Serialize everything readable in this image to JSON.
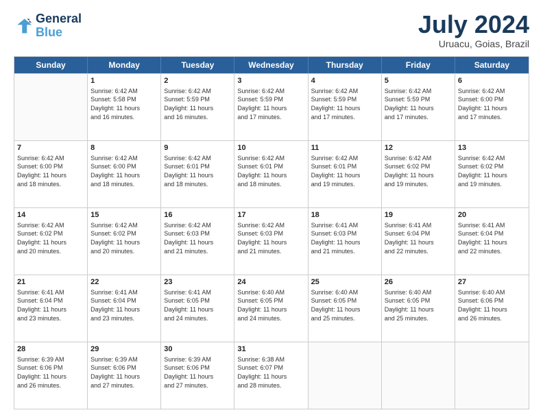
{
  "logo": {
    "line1": "General",
    "line2": "Blue"
  },
  "title": "July 2024",
  "location": "Uruacu, Goias, Brazil",
  "days_of_week": [
    "Sunday",
    "Monday",
    "Tuesday",
    "Wednesday",
    "Thursday",
    "Friday",
    "Saturday"
  ],
  "weeks": [
    [
      {
        "day": "",
        "info": ""
      },
      {
        "day": "1",
        "info": "Sunrise: 6:42 AM\nSunset: 5:58 PM\nDaylight: 11 hours\nand 16 minutes."
      },
      {
        "day": "2",
        "info": "Sunrise: 6:42 AM\nSunset: 5:59 PM\nDaylight: 11 hours\nand 16 minutes."
      },
      {
        "day": "3",
        "info": "Sunrise: 6:42 AM\nSunset: 5:59 PM\nDaylight: 11 hours\nand 17 minutes."
      },
      {
        "day": "4",
        "info": "Sunrise: 6:42 AM\nSunset: 5:59 PM\nDaylight: 11 hours\nand 17 minutes."
      },
      {
        "day": "5",
        "info": "Sunrise: 6:42 AM\nSunset: 5:59 PM\nDaylight: 11 hours\nand 17 minutes."
      },
      {
        "day": "6",
        "info": "Sunrise: 6:42 AM\nSunset: 6:00 PM\nDaylight: 11 hours\nand 17 minutes."
      }
    ],
    [
      {
        "day": "7",
        "info": "Sunrise: 6:42 AM\nSunset: 6:00 PM\nDaylight: 11 hours\nand 18 minutes."
      },
      {
        "day": "8",
        "info": "Sunrise: 6:42 AM\nSunset: 6:00 PM\nDaylight: 11 hours\nand 18 minutes."
      },
      {
        "day": "9",
        "info": "Sunrise: 6:42 AM\nSunset: 6:01 PM\nDaylight: 11 hours\nand 18 minutes."
      },
      {
        "day": "10",
        "info": "Sunrise: 6:42 AM\nSunset: 6:01 PM\nDaylight: 11 hours\nand 18 minutes."
      },
      {
        "day": "11",
        "info": "Sunrise: 6:42 AM\nSunset: 6:01 PM\nDaylight: 11 hours\nand 19 minutes."
      },
      {
        "day": "12",
        "info": "Sunrise: 6:42 AM\nSunset: 6:02 PM\nDaylight: 11 hours\nand 19 minutes."
      },
      {
        "day": "13",
        "info": "Sunrise: 6:42 AM\nSunset: 6:02 PM\nDaylight: 11 hours\nand 19 minutes."
      }
    ],
    [
      {
        "day": "14",
        "info": "Sunrise: 6:42 AM\nSunset: 6:02 PM\nDaylight: 11 hours\nand 20 minutes."
      },
      {
        "day": "15",
        "info": "Sunrise: 6:42 AM\nSunset: 6:02 PM\nDaylight: 11 hours\nand 20 minutes."
      },
      {
        "day": "16",
        "info": "Sunrise: 6:42 AM\nSunset: 6:03 PM\nDaylight: 11 hours\nand 21 minutes."
      },
      {
        "day": "17",
        "info": "Sunrise: 6:42 AM\nSunset: 6:03 PM\nDaylight: 11 hours\nand 21 minutes."
      },
      {
        "day": "18",
        "info": "Sunrise: 6:41 AM\nSunset: 6:03 PM\nDaylight: 11 hours\nand 21 minutes."
      },
      {
        "day": "19",
        "info": "Sunrise: 6:41 AM\nSunset: 6:04 PM\nDaylight: 11 hours\nand 22 minutes."
      },
      {
        "day": "20",
        "info": "Sunrise: 6:41 AM\nSunset: 6:04 PM\nDaylight: 11 hours\nand 22 minutes."
      }
    ],
    [
      {
        "day": "21",
        "info": "Sunrise: 6:41 AM\nSunset: 6:04 PM\nDaylight: 11 hours\nand 23 minutes."
      },
      {
        "day": "22",
        "info": "Sunrise: 6:41 AM\nSunset: 6:04 PM\nDaylight: 11 hours\nand 23 minutes."
      },
      {
        "day": "23",
        "info": "Sunrise: 6:41 AM\nSunset: 6:05 PM\nDaylight: 11 hours\nand 24 minutes."
      },
      {
        "day": "24",
        "info": "Sunrise: 6:40 AM\nSunset: 6:05 PM\nDaylight: 11 hours\nand 24 minutes."
      },
      {
        "day": "25",
        "info": "Sunrise: 6:40 AM\nSunset: 6:05 PM\nDaylight: 11 hours\nand 25 minutes."
      },
      {
        "day": "26",
        "info": "Sunrise: 6:40 AM\nSunset: 6:05 PM\nDaylight: 11 hours\nand 25 minutes."
      },
      {
        "day": "27",
        "info": "Sunrise: 6:40 AM\nSunset: 6:06 PM\nDaylight: 11 hours\nand 26 minutes."
      }
    ],
    [
      {
        "day": "28",
        "info": "Sunrise: 6:39 AM\nSunset: 6:06 PM\nDaylight: 11 hours\nand 26 minutes."
      },
      {
        "day": "29",
        "info": "Sunrise: 6:39 AM\nSunset: 6:06 PM\nDaylight: 11 hours\nand 27 minutes."
      },
      {
        "day": "30",
        "info": "Sunrise: 6:39 AM\nSunset: 6:06 PM\nDaylight: 11 hours\nand 27 minutes."
      },
      {
        "day": "31",
        "info": "Sunrise: 6:38 AM\nSunset: 6:07 PM\nDaylight: 11 hours\nand 28 minutes."
      },
      {
        "day": "",
        "info": ""
      },
      {
        "day": "",
        "info": ""
      },
      {
        "day": "",
        "info": ""
      }
    ]
  ]
}
